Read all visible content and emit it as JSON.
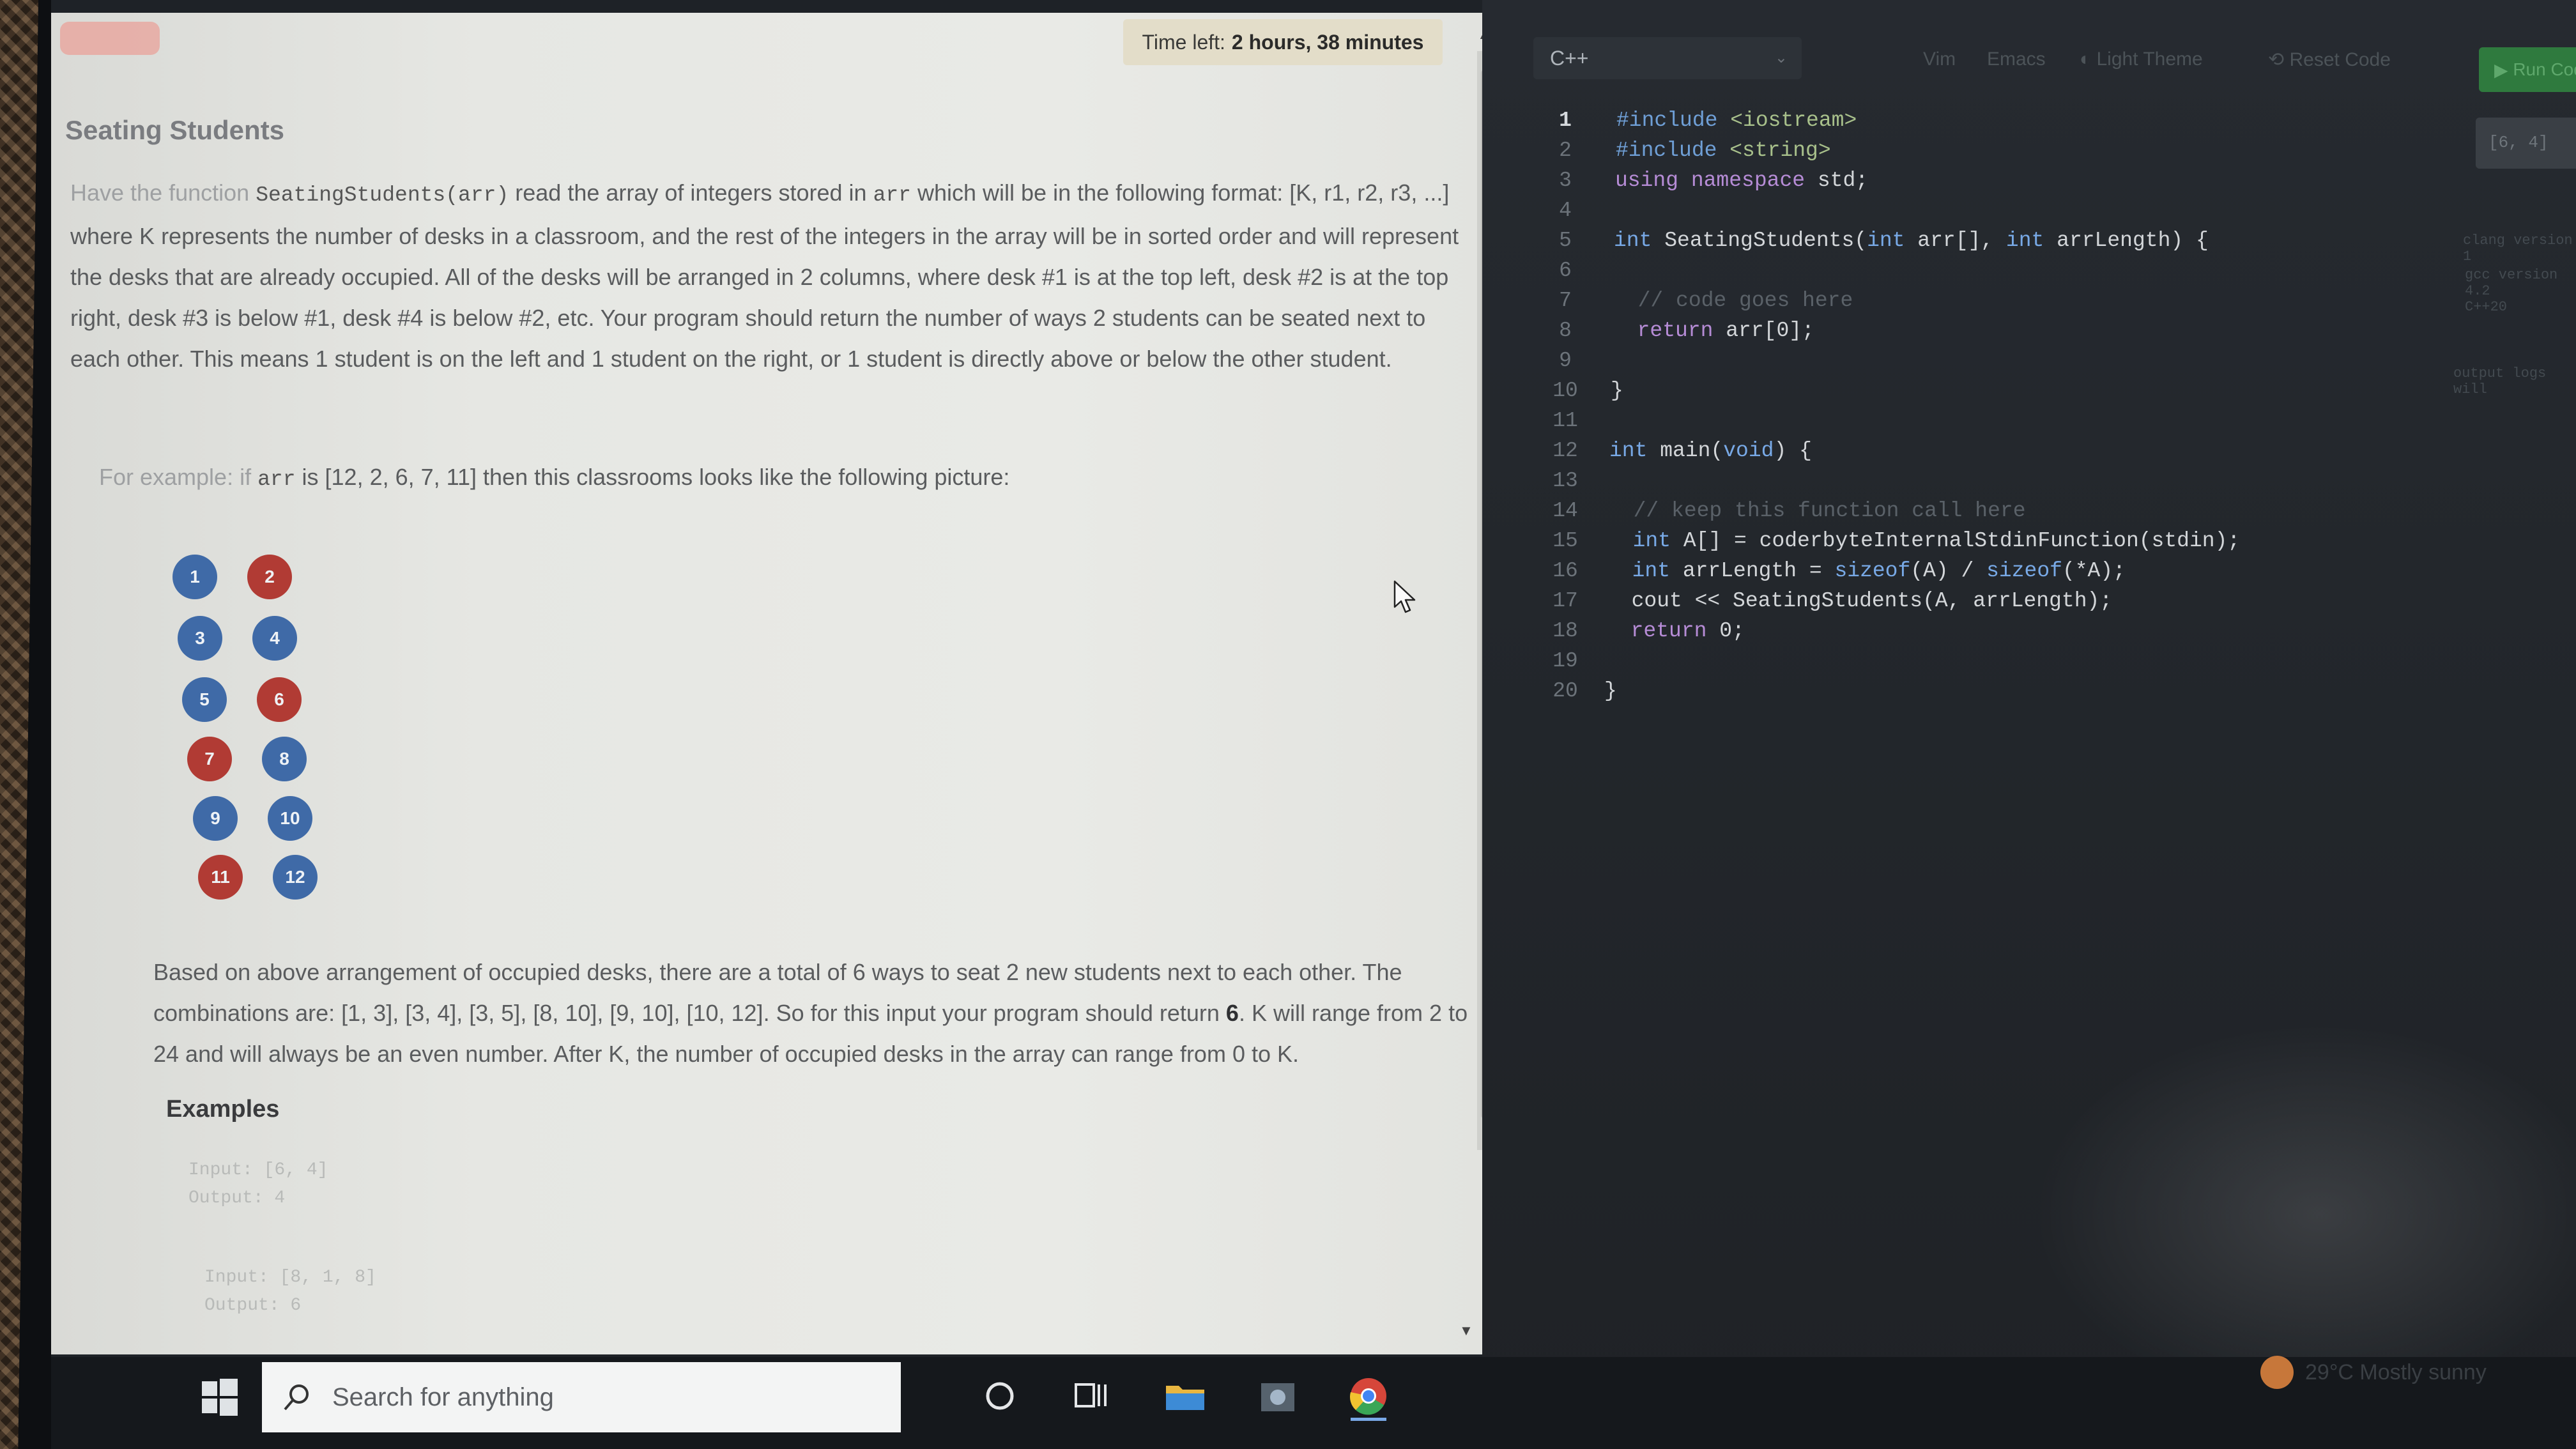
{
  "problem": {
    "timer_label": "Time left:",
    "timer_value": "2 hours, 38 minutes",
    "title": "Seating Students",
    "p1_a": "Have the function ",
    "p1_fn": "SeatingStudents(arr)",
    "p1_b": " read the array of integers stored in ",
    "p1_arr": "arr",
    "p1_c": " which will be in the following format: [K, r1, r2, r3, ...] where K represents the number of desks in a classroom, and the rest of the integers in the array will be in sorted order and will represent the desks that are already occupied. All of the desks will be arranged in 2 columns, where desk #1 is at the top left, desk #2 is at the top right, desk #3 is below #1, desk #4 is below #2, etc. Your program should return the number of ways 2 students can be seated next to each other. This means 1 student is on the left and 1 student on the right, or 1 student is directly above or below the other student.",
    "p2_a": "For example: if ",
    "p2_arr": "arr",
    "p2_b": " is [12, 2, 6, 7, 11] then this classrooms looks like the following picture:",
    "desks": [
      {
        "n": "1",
        "occupied": false
      },
      {
        "n": "2",
        "occupied": true
      },
      {
        "n": "3",
        "occupied": false
      },
      {
        "n": "4",
        "occupied": false
      },
      {
        "n": "5",
        "occupied": false
      },
      {
        "n": "6",
        "occupied": true
      },
      {
        "n": "7",
        "occupied": true
      },
      {
        "n": "8",
        "occupied": false
      },
      {
        "n": "9",
        "occupied": false
      },
      {
        "n": "10",
        "occupied": false
      },
      {
        "n": "11",
        "occupied": true
      },
      {
        "n": "12",
        "occupied": false
      }
    ],
    "p3_a": "Based on above arrangement of occupied desks, there are a total of 6 ways to seat 2 new students next to each other. The combinations are: [1, 3], [3, 4], [3, 5], [8, 10], [9, 10], [10, 12]. So for this input your program should return ",
    "p3_bold": "6",
    "p3_b": ". K will range from 2 to 24 and will always be an even number. After K, the number of occupied desks in the array can range from 0 to K.",
    "examples_title": "Examples",
    "examples": [
      {
        "input": "Input: [6, 4]",
        "output": "Output: 4"
      },
      {
        "input": "Input: [8, 1, 8]",
        "output": "Output: 6"
      }
    ]
  },
  "editor": {
    "language": "C++",
    "vim_label": "Vim",
    "emacs_label": "Emacs",
    "light_theme_label": "Light Theme",
    "reset_label": "Reset Code",
    "run_label": "Run Code",
    "side_input": "[6, 4]",
    "side_notes": [
      "clang version 1",
      "gcc version 4.2",
      "C++20",
      "output logs will"
    ],
    "lines": [
      {
        "n": "1",
        "tokens": [
          {
            "t": "#include ",
            "c": "pp"
          },
          {
            "t": "<iostream>",
            "c": "str"
          }
        ]
      },
      {
        "n": "2",
        "tokens": [
          {
            "t": "#include ",
            "c": "pp"
          },
          {
            "t": "<string>",
            "c": "str"
          }
        ]
      },
      {
        "n": "3",
        "tokens": [
          {
            "t": "using ",
            "c": "kw"
          },
          {
            "t": "namespace ",
            "c": "kw"
          },
          {
            "t": "std;",
            "c": ""
          }
        ]
      },
      {
        "n": "4",
        "tokens": []
      },
      {
        "n": "5",
        "tokens": [
          {
            "t": "int ",
            "c": "ty"
          },
          {
            "t": "SeatingStudents(",
            "c": ""
          },
          {
            "t": "int ",
            "c": "ty"
          },
          {
            "t": "arr[], ",
            "c": ""
          },
          {
            "t": "int ",
            "c": "ty"
          },
          {
            "t": "arrLength) {",
            "c": ""
          }
        ]
      },
      {
        "n": "6",
        "tokens": []
      },
      {
        "n": "7",
        "tokens": [
          {
            "t": "  // code goes here",
            "c": "cm"
          }
        ]
      },
      {
        "n": "8",
        "tokens": [
          {
            "t": "  return ",
            "c": "kw"
          },
          {
            "t": "arr[0];",
            "c": ""
          }
        ]
      },
      {
        "n": "9",
        "tokens": []
      },
      {
        "n": "10",
        "tokens": [
          {
            "t": "}",
            "c": ""
          }
        ]
      },
      {
        "n": "11",
        "tokens": []
      },
      {
        "n": "12",
        "tokens": [
          {
            "t": "int ",
            "c": "ty"
          },
          {
            "t": "main(",
            "c": ""
          },
          {
            "t": "void",
            "c": "ty"
          },
          {
            "t": ") {",
            "c": ""
          }
        ]
      },
      {
        "n": "13",
        "tokens": []
      },
      {
        "n": "14",
        "tokens": [
          {
            "t": "  // keep this function call here",
            "c": "cm"
          }
        ]
      },
      {
        "n": "15",
        "tokens": [
          {
            "t": "  int ",
            "c": "ty"
          },
          {
            "t": "A[] = coderbyteInternalStdinFunction(stdin);",
            "c": ""
          }
        ]
      },
      {
        "n": "16",
        "tokens": [
          {
            "t": "  int ",
            "c": "ty"
          },
          {
            "t": "arrLength = ",
            "c": ""
          },
          {
            "t": "sizeof",
            "c": "ty"
          },
          {
            "t": "(A) / ",
            "c": ""
          },
          {
            "t": "sizeof",
            "c": "ty"
          },
          {
            "t": "(*A);",
            "c": ""
          }
        ]
      },
      {
        "n": "17",
        "tokens": [
          {
            "t": "  cout << SeatingStudents(A, arrLength);",
            "c": ""
          }
        ]
      },
      {
        "n": "18",
        "tokens": [
          {
            "t": "  return ",
            "c": "kw"
          },
          {
            "t": "0;",
            "c": ""
          }
        ]
      },
      {
        "n": "19",
        "tokens": []
      },
      {
        "n": "20",
        "tokens": [
          {
            "t": "}",
            "c": ""
          }
        ]
      }
    ]
  },
  "taskbar": {
    "search_placeholder": "Search for anything",
    "weather": "29°C  Mostly sunny"
  },
  "colors": {
    "desk_free": "#3f6aa7",
    "desk_taken": "#b13b34",
    "run_button": "#2f7a3e"
  }
}
